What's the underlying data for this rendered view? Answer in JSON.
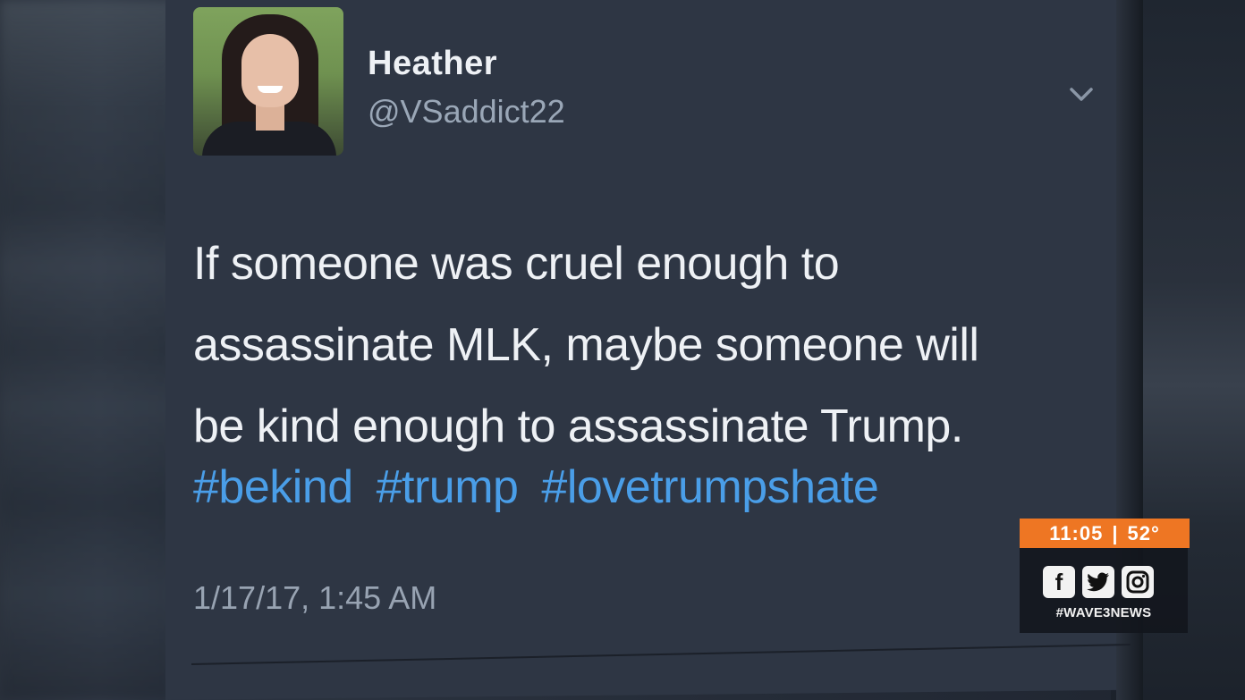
{
  "tweet": {
    "name": "Heather",
    "handle": "@VSaddict22",
    "text_lines": [
      "If someone was cruel enough to",
      "assassinate MLK, maybe someone will",
      "be kind enough to assassinate Trump."
    ],
    "hashtags": [
      "#bekind",
      "#trump",
      "#lovetrumpshate"
    ],
    "timestamp": "1/17/17, 1:45 AM"
  },
  "news_bug": {
    "time": "11:05",
    "separator": "|",
    "temperature": "52°",
    "icons": [
      "facebook-icon",
      "twitter-icon",
      "instagram-icon"
    ],
    "hashtag": "#WAVE3NEWS"
  },
  "colors": {
    "card_bg": "#2e3644",
    "hashtag": "#4a9ee8",
    "bug_orange": "#ee7623"
  }
}
